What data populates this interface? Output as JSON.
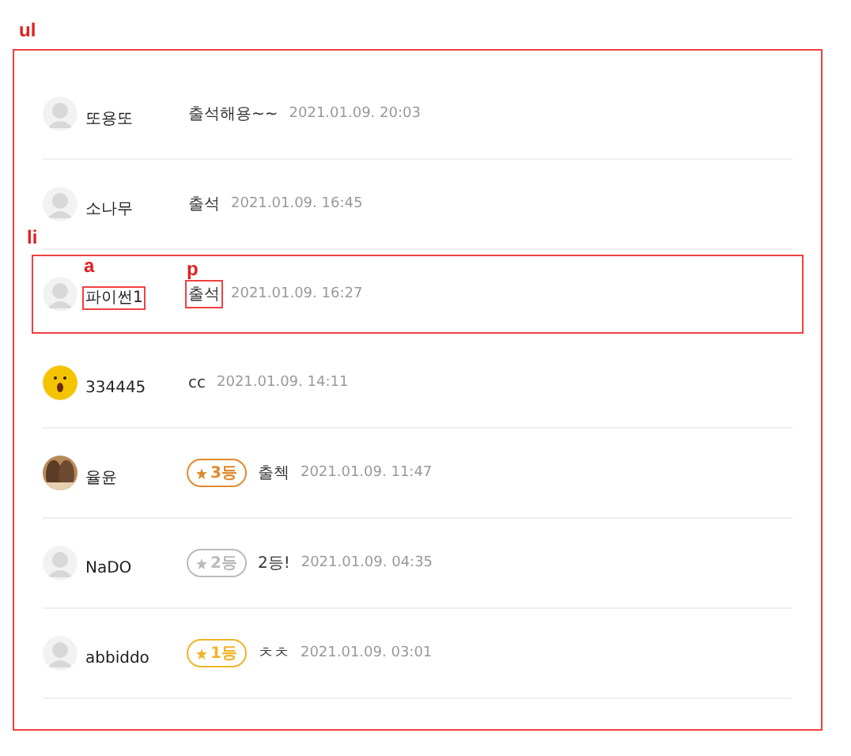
{
  "list_label": "ul",
  "rows": [
    {
      "name": "또용또",
      "avatar": {
        "kind": "default"
      },
      "message": "출석해용~~",
      "time": "2021.01.09. 20:03",
      "annotated": false
    },
    {
      "name": "소나무",
      "avatar": {
        "kind": "default"
      },
      "message": "출석",
      "time": "2021.01.09. 16:45",
      "annotated": false
    },
    {
      "name": "파이썬1",
      "avatar": {
        "kind": "default"
      },
      "message": "출석",
      "time": "2021.01.09. 16:27",
      "annotated": true,
      "annotation": {
        "row_label": "li",
        "name_label": "a",
        "message_label": "p"
      }
    },
    {
      "name": "334445",
      "avatar": {
        "kind": "emoji"
      },
      "message": "cc",
      "time": "2021.01.09. 14:11",
      "annotated": false
    },
    {
      "name": "율윤",
      "badge": {
        "text": "3등",
        "color": "#e08a2c"
      },
      "message": "출첵",
      "time": "2021.01.09. 11:47",
      "annotated": false
    },
    {
      "name": "NaDO",
      "avatar": {
        "kind": "default"
      },
      "badge": {
        "text": "2등",
        "color": "#bbbbbb"
      },
      "message": "2등!",
      "time": "2021.01.09. 04:35",
      "annotated": false
    },
    {
      "name": "abbiddo",
      "avatar": {
        "kind": "default"
      },
      "badge": {
        "text": "1등",
        "color": "#f0b429"
      },
      "message": "ㅊㅊ",
      "time": "2021.01.09. 03:01",
      "annotated": false
    }
  ]
}
